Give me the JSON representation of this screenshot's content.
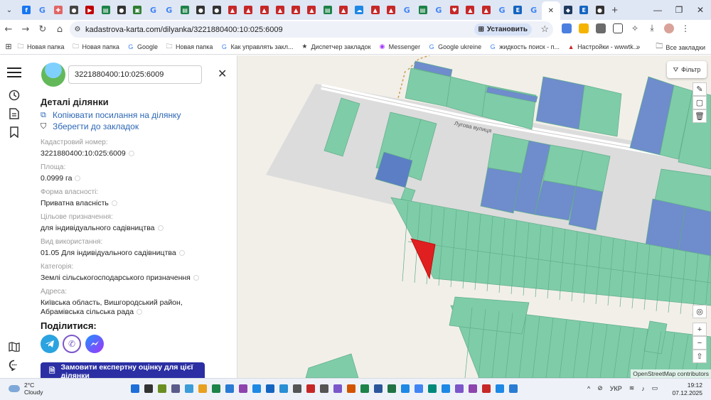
{
  "browser": {
    "tabs": [
      {
        "icon": "facebook-icon",
        "color": "#1877f2",
        "glyph": "f"
      },
      {
        "icon": "google-icon",
        "color": "#ffffff",
        "glyph": "G"
      },
      {
        "icon": "pin-icon",
        "color": "#e06666",
        "glyph": "✚"
      },
      {
        "icon": "site-icon",
        "color": "#444444",
        "glyph": "●"
      },
      {
        "icon": "media-icon",
        "color": "#c00000",
        "glyph": "▶"
      },
      {
        "icon": "sheet-icon",
        "color": "#1d8348",
        "glyph": "▤"
      },
      {
        "icon": "site-icon",
        "color": "#333333",
        "glyph": "●"
      },
      {
        "icon": "document-icon",
        "color": "#2e7d32",
        "glyph": "▣"
      },
      {
        "icon": "google-icon",
        "color": "#ffffff",
        "glyph": "G"
      },
      {
        "icon": "google-icon",
        "color": "#ffffff",
        "glyph": "G"
      },
      {
        "icon": "sheet-icon",
        "color": "#1d8348",
        "glyph": "▤"
      },
      {
        "icon": "site-icon",
        "color": "#333333",
        "glyph": "●"
      },
      {
        "icon": "site-icon",
        "color": "#333333",
        "glyph": "●"
      },
      {
        "icon": "pdf-icon",
        "color": "#c62828",
        "glyph": "▲"
      },
      {
        "icon": "pdf-icon",
        "color": "#c62828",
        "glyph": "▲"
      },
      {
        "icon": "pdf-icon",
        "color": "#c62828",
        "glyph": "▲"
      },
      {
        "icon": "pdf-icon",
        "color": "#c62828",
        "glyph": "▲"
      },
      {
        "icon": "pdf-icon",
        "color": "#c62828",
        "glyph": "▲"
      },
      {
        "icon": "pdf-icon",
        "color": "#c62828",
        "glyph": "▲"
      },
      {
        "icon": "sheet-icon",
        "color": "#1d8348",
        "glyph": "▤"
      },
      {
        "icon": "pdf-icon",
        "color": "#c62828",
        "glyph": "▲"
      },
      {
        "icon": "cloud-icon",
        "color": "#1e88e5",
        "glyph": "☁"
      },
      {
        "icon": "pdf-icon",
        "color": "#c62828",
        "glyph": "▲"
      },
      {
        "icon": "pdf-icon",
        "color": "#c62828",
        "glyph": "▲"
      },
      {
        "icon": "google-icon",
        "color": "#ffffff",
        "glyph": "G"
      },
      {
        "icon": "sheet-icon",
        "color": "#1d8348",
        "glyph": "▤"
      },
      {
        "icon": "google-icon",
        "color": "#ffffff",
        "glyph": "G"
      },
      {
        "icon": "heart-icon",
        "color": "#c62828",
        "glyph": "♥"
      },
      {
        "icon": "pdf-icon",
        "color": "#c62828",
        "glyph": "▲"
      },
      {
        "icon": "pdf-icon",
        "color": "#c62828",
        "glyph": "▲"
      },
      {
        "icon": "google-icon",
        "color": "#ffffff",
        "glyph": "G"
      },
      {
        "icon": "word-icon",
        "color": "#1565c0",
        "glyph": "E"
      },
      {
        "icon": "google-icon",
        "color": "#ffffff",
        "glyph": "G"
      }
    ],
    "active_tab": {
      "icon": "close-icon",
      "glyph": "✕"
    },
    "after_tabs": [
      {
        "icon": "map-icon",
        "color": "#1e3a5f",
        "glyph": "◆"
      },
      {
        "icon": "word-icon",
        "color": "#1565c0",
        "glyph": "E"
      },
      {
        "icon": "site-icon",
        "color": "#333333",
        "glyph": "●"
      }
    ],
    "url": "kadastrova-karta.com/dilyanka/3221880400:10:025:6009",
    "install_label": "Установить",
    "bookmarks": [
      {
        "icon": "folder-icon",
        "label": "Новая папка"
      },
      {
        "icon": "folder-icon",
        "label": "Новая папка"
      },
      {
        "icon": "google-icon",
        "label": "Google"
      },
      {
        "icon": "folder-icon",
        "label": "Новая папка"
      },
      {
        "icon": "google-icon",
        "label": "Как управлять закл..."
      },
      {
        "icon": "star-icon",
        "label": "Диспетчер закладок"
      },
      {
        "icon": "messenger-icon",
        "label": "Messenger"
      },
      {
        "icon": "google-icon",
        "label": "Google ukreine"
      },
      {
        "icon": "google-icon",
        "label": "жидкость поиск - п..."
      },
      {
        "icon": "pdf-icon",
        "label": "Настройки - wwwtk..."
      }
    ],
    "all_bookmarks_label": "Все закладки"
  },
  "panel": {
    "search_value": "3221880400:10:025:6009",
    "title": "Деталі ділянки",
    "copy_link": "Копіювати посилання на ділянку",
    "save_bookmark": "Зберегти до закладок",
    "fields": [
      {
        "label": "Кадастровий номер:",
        "value": "3221880400:10:025:6009"
      },
      {
        "label": "Площа:",
        "value": "0.0999 га"
      },
      {
        "label": "Форма власності:",
        "value": "Приватна власність"
      },
      {
        "label": "Цільове призначення:",
        "value": "для індивідуального садівництва"
      },
      {
        "label": "Вид використання:",
        "value": "01.05 Для індивідуального садівництва"
      },
      {
        "label": "Категорія:",
        "value": "Землі сільськогосподарського призначення"
      },
      {
        "label": "Адреса:",
        "value": "Київська область, Вишгородський район, Абрамівська сільська рада"
      }
    ],
    "share_title": "Поділитися:",
    "order_button": "Замовити експертну оцінку для цієї ділянки"
  },
  "map": {
    "filter_label": "Фільтр",
    "street_label": "Лугова вулиця",
    "attribution": "OpenStreetMap contributors",
    "colors": {
      "parcel": "#7fcca8",
      "parcel_blue": "#6f8ccc",
      "selected": "#e02020",
      "road": "#e2e2e2"
    }
  },
  "taskbar": {
    "temperature": "2°C",
    "weather": "Cloudy",
    "language": "УКР",
    "time": "19:12",
    "date": "07.12.2025"
  }
}
